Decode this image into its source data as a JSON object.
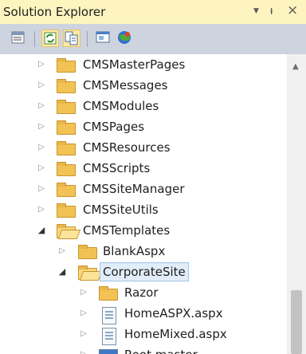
{
  "window": {
    "title": "Solution Explorer",
    "controls": {
      "dropdown": "▼",
      "pin": "ᵼ",
      "close": "×"
    }
  },
  "toolbar": {
    "buttons": [
      {
        "name": "properties-button",
        "icon": "properties-icon",
        "active": false
      },
      {
        "name": "refresh-button",
        "icon": "refresh-icon",
        "active": true
      },
      {
        "name": "show-all-files-button",
        "icon": "show-all-files-icon",
        "active": true
      },
      {
        "name": "view-designer-button",
        "icon": "view-designer-icon",
        "active": false
      },
      {
        "name": "view-in-browser-button",
        "icon": "browser-icon",
        "active": false
      }
    ]
  },
  "tree": {
    "items": [
      {
        "label": "CMSMasterPages",
        "type": "folder",
        "level": 1,
        "expanded": false
      },
      {
        "label": "CMSMessages",
        "type": "folder",
        "level": 1,
        "expanded": false
      },
      {
        "label": "CMSModules",
        "type": "folder",
        "level": 1,
        "expanded": false
      },
      {
        "label": "CMSPages",
        "type": "folder",
        "level": 1,
        "expanded": false
      },
      {
        "label": "CMSResources",
        "type": "folder",
        "level": 1,
        "expanded": false
      },
      {
        "label": "CMSScripts",
        "type": "folder",
        "level": 1,
        "expanded": false
      },
      {
        "label": "CMSSiteManager",
        "type": "folder",
        "level": 1,
        "expanded": false
      },
      {
        "label": "CMSSiteUtils",
        "type": "folder",
        "level": 1,
        "expanded": false
      },
      {
        "label": "CMSTemplates",
        "type": "folder",
        "level": 1,
        "expanded": true
      },
      {
        "label": "BlankAspx",
        "type": "folder",
        "level": 2,
        "expanded": false
      },
      {
        "label": "CorporateSite",
        "type": "folder",
        "level": 2,
        "expanded": true,
        "selected": true
      },
      {
        "label": "Razor",
        "type": "folder",
        "level": 3,
        "expanded": false
      },
      {
        "label": "HomeASPX.aspx",
        "type": "aspx",
        "level": 3,
        "expanded": false
      },
      {
        "label": "HomeMixed.aspx",
        "type": "aspx",
        "level": 3,
        "expanded": false
      },
      {
        "label": "Root.master",
        "type": "master",
        "level": 3,
        "expanded": false
      }
    ]
  },
  "colors": {
    "title_bg": "#fdf4bf",
    "toolbar_bg": "#ced4df",
    "selection_bg": "#e1edf9",
    "folder": "#f2c354"
  }
}
